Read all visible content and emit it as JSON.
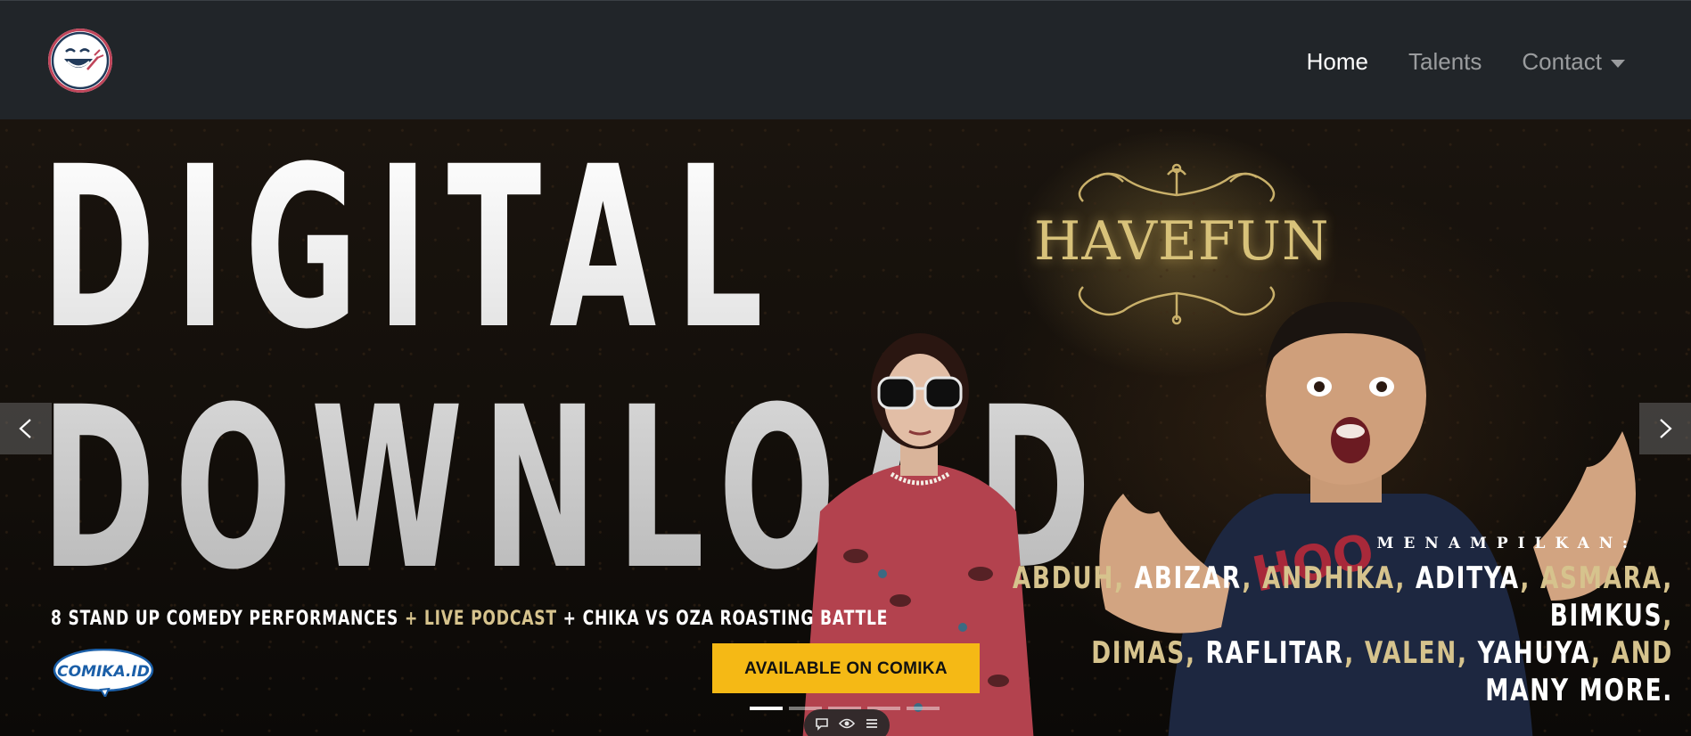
{
  "nav": {
    "links": [
      {
        "label": "Home",
        "active": true
      },
      {
        "label": "Talents",
        "active": false
      },
      {
        "label": "Contact",
        "active": false
      }
    ]
  },
  "hero": {
    "title_line1": "DIGITAL",
    "title_line2": "DOWNLOAD",
    "brand_sign": "HAVEFUN",
    "menampilkan": "MENAMPILKAN:",
    "talents": [
      "ABDUH",
      "ABIZAR",
      "ANDHIKA",
      "ADITYA",
      "ASMARA",
      "BIMKUS",
      "DIMAS",
      "RAFLITAR",
      "VALEN",
      "YAHUYA"
    ],
    "talents_and": "AND",
    "talents_more": "MANY MORE.",
    "tagline_part1": "8 STAND UP COMEDY PERFORMANCES",
    "tagline_plus1": "+",
    "tagline_part2": "LIVE PODCAST",
    "tagline_plus2": "+",
    "tagline_part3": "CHIKA VS OZA ROASTING BATTLE",
    "partner_logo": "COMIKA.ID",
    "cta_label": "AVAILABLE ON COMIKA"
  },
  "carousel": {
    "slide_count": 5,
    "active_index": 0,
    "prev_icon": "chevron-left-icon",
    "next_icon": "chevron-right-icon"
  },
  "toolbar_icons": [
    "comment-icon",
    "eye-icon",
    "menu-icon"
  ],
  "colors": {
    "navbar_bg": "#212529",
    "cta_bg": "#f5b915",
    "talent_gold": "#d6c38d",
    "sign_gold": "#d8c27a"
  }
}
